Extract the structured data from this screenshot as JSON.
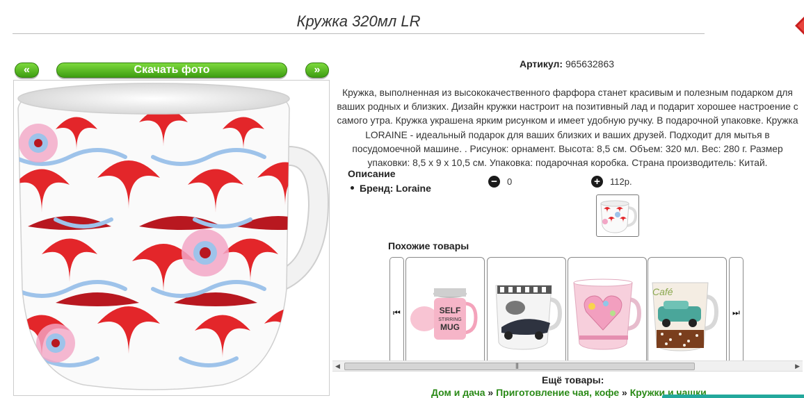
{
  "header": {
    "title": "Кружка 320мл LR"
  },
  "nav": {
    "prev_label": "«",
    "download_label": "Скачать фото",
    "next_label": "»"
  },
  "product": {
    "article_label": "Артикул:",
    "article_value": "965632863",
    "description": "Кружка, выполненная из высококачественного фарфора станет красивым и полезным подарком для ваших родных и близких. Дизайн кружки настроит на позитивный лад и подарит хорошее настроение с самого утра. Кружка украшена ярким рисунком и имеет удобную ручку. В подарочной упаковке. Кружка LORAINE - идеальный подарок для ваших близких и ваших друзей. Подходит для мытья в посудомоечной машине. . Рисунок: орнамент. Высота: 8,5 см. Объем: 320 мл. Вес: 280 г. Размер упаковки: 8,5 х 9 х 10,5 см. Упаковка: подарочная коробка. Страна производитель: Китай.",
    "specs_title": "Описание",
    "brand_label": "Бренд: Loraine",
    "qty_value": "0",
    "price": "112р.",
    "minus_glyph": "−",
    "plus_glyph": "+"
  },
  "similar": {
    "title": "Похожие товары",
    "left_glyph": "⏮",
    "right_glyph": "⏭",
    "items": [
      {
        "name": "self-stirring-mug",
        "label_line1": "SELF",
        "label_line2": "STIRRING",
        "label_line3": "MUG"
      },
      {
        "name": "car-mug"
      },
      {
        "name": "heart-mug"
      },
      {
        "name": "car-cafe-mug",
        "label": "Café"
      }
    ]
  },
  "scroll": {
    "left_glyph": "◀",
    "right_glyph": "▶",
    "grip": "|||"
  },
  "more": {
    "title": "Ещё товары:",
    "crumb1": "Дом и дача",
    "crumb2": "Приготовление чая, кофе",
    "crumb3": "Кружки и чашки",
    "sep": " » "
  },
  "colors": {
    "accent_green": "#3e9e12",
    "link_green": "#2a8a17",
    "pattern_red": "#e3262a",
    "pattern_blue": "#9ec3ea",
    "pattern_pink": "#f2a6c6"
  }
}
